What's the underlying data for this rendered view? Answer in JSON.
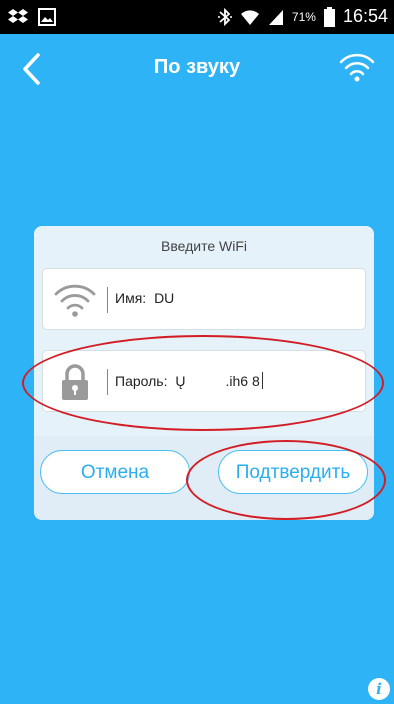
{
  "status_bar": {
    "battery_percent": "71%",
    "time": "16:54",
    "icons": [
      "dropbox-icon",
      "gallery-icon",
      "bluetooth-icon",
      "wifi-signal-icon",
      "cell-signal-icon",
      "battery-icon"
    ]
  },
  "header": {
    "title": "По звуку",
    "back_icon": "chevron-left-icon",
    "wifi_icon": "wifi-icon"
  },
  "dialog": {
    "title": "Введите WiFi",
    "name_field": {
      "label": "Имя:",
      "value": "DU",
      "icon": "wifi-icon"
    },
    "password_field": {
      "label": "Пароль:",
      "value_start": "Ų",
      "value_end": ".ih6  8",
      "icon": "lock-icon"
    },
    "cancel_label": "Отмена",
    "confirm_label": "Подтвердить"
  },
  "colors": {
    "background": "#2eb4f6",
    "accent": "#2aaef0",
    "annotation": "#d31d25"
  },
  "info_icon": "info-icon",
  "info_label": "i"
}
